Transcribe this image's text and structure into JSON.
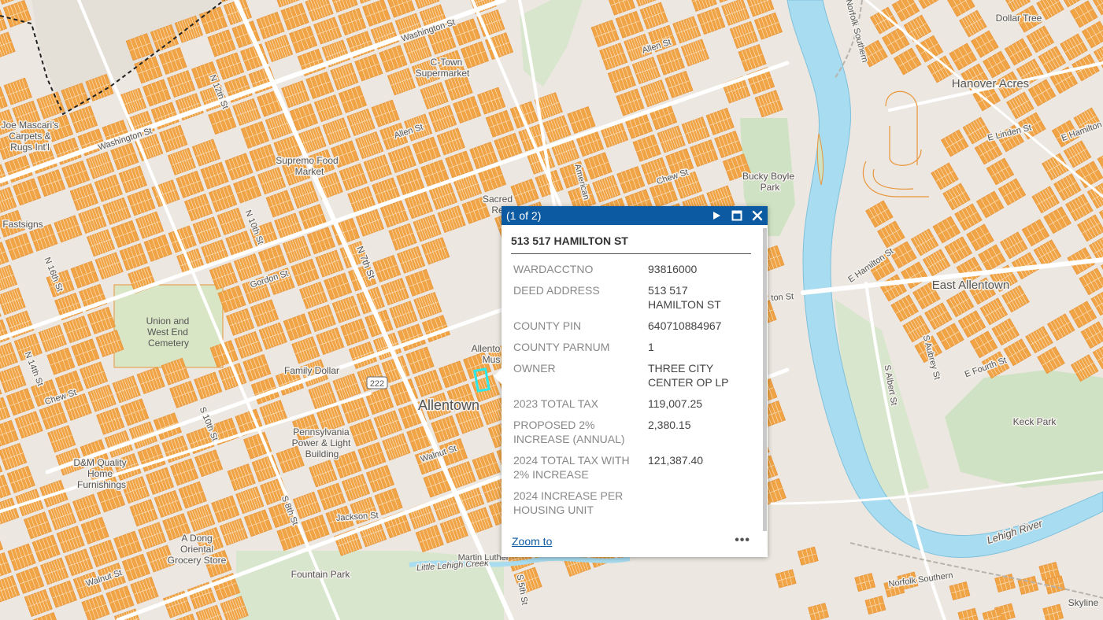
{
  "map": {
    "colors": {
      "background": "#ece8e1",
      "parcel_fill": "#f0a445",
      "parcel_line": "#e8953b",
      "road": "#ffffff",
      "river": "#a8dcf0",
      "river_edge": "#7fc0dc",
      "park": "#cfe2c3",
      "cemetery": "#d9e6c6",
      "selected": "#2ee7e7"
    },
    "labels": {
      "place_hanover_acres": "Hanover Acres",
      "place_east_allentown": "East Allentown",
      "place_allentown": "Allentown",
      "park_bucky_boyle_1": "Bucky Boyle",
      "park_bucky_boyle_2": "Park",
      "park_keck": "Keck Park",
      "park_fountain": "Fountain Park",
      "cemetery_1": "Union and",
      "cemetery_2": "West End",
      "cemetery_3": "Cemetery",
      "river_lehigh": "Lehigh River",
      "creek_little_lehigh": "Little Lehigh Creek",
      "rail_norfolk_1": "Norfolk Southern",
      "rail_norfolk_2": "Norfolk Southern",
      "poi_mascaris_1": "Joe Mascari's",
      "poi_mascaris_2": "Carpets &",
      "poi_mascaris_3": "Rugs Int'l",
      "poi_fastsigns": "Fastsigns",
      "poi_supremo_1": "Supremo Food",
      "poi_supremo_2": "Market",
      "poi_ctown_1": "C-Town",
      "poi_ctown_2": "Supermarket",
      "poi_family_dollar": "Family Dollar",
      "poi_ppl_1": "Pennsylvania",
      "poi_ppl_2": "Power & Light",
      "poi_ppl_3": "Building",
      "poi_dm_1": "D&M Quality",
      "poi_dm_2": "Home",
      "poi_dm_3": "Furnishings",
      "poi_adong_1": "A Dong",
      "poi_adong_2": "Oriental",
      "poi_adong_3": "Grocery Store",
      "poi_dollar_tree": "Dollar Tree",
      "poi_skyline": "Skyline",
      "poi_allentown_museum_1": "Allento",
      "poi_allentown_museum_2": "Mus",
      "poi_sacred_1": "Sacred",
      "poi_sacred_2": "Re",
      "st_washington_1": "Washington St",
      "st_washington_2": "Washington St",
      "st_allen_1": "Allen St",
      "st_allen_2": "Allen St",
      "st_gordon": "Gordon St",
      "st_chew_1": "Chew St",
      "st_chew_2": "Chew St",
      "st_walnut_1": "Walnut St",
      "st_walnut_2": "Walnut St",
      "st_jackson": "Jackson St",
      "st_linden": "E Linden St",
      "st_e_hamilton_1": "E Hamilton St",
      "st_e_hamilton_2": "E Hamilton",
      "st_hamilton_bridge": "ton St",
      "st_n7th": "N 7th St",
      "st_n12th": "N 12th St",
      "st_n10th": "N 10th St",
      "st_n14th": "N 14th St",
      "st_n16th": "N 16th St",
      "st_s10th": "S 10th St",
      "st_s5th": "S 5th St",
      "st_s8th": "S 8th St",
      "st_s_albert": "S Albert St",
      "st_s_aubrey": "S Aubrey St",
      "st_american": "American",
      "st_e_fourth": "E Fourth St",
      "st_e_fifth": "E Fifth St",
      "st_martin_luther": "Martin Luther",
      "route_222": "222",
      "route_222_alt": "222"
    }
  },
  "popup": {
    "count": "(1 of 2)",
    "title": "513 517 HAMILTON ST",
    "fields": [
      {
        "key": "WARDACCTNO",
        "value": "93816000"
      },
      {
        "key": "DEED ADDRESS",
        "value": "513 517\nHAMILTON ST"
      },
      {
        "key": "COUNTY PIN",
        "value": "640710884967"
      },
      {
        "key": "COUNTY PARNUM",
        "value": "1"
      },
      {
        "key": "OWNER",
        "value": "THREE CITY\nCENTER OP LP"
      },
      {
        "key": "2023 TOTAL TAX",
        "value": "119,007.25"
      },
      {
        "key": "PROPOSED 2%\nINCREASE (ANNUAL)",
        "value": "2,380.15"
      },
      {
        "key": "2024 TOTAL TAX WITH\n2% INCREASE",
        "value": "121,387.40"
      },
      {
        "key": "2024 INCREASE PER\nHOUSING UNIT",
        "value": ""
      }
    ],
    "zoom_to": "Zoom to",
    "more": "•••",
    "icons": {
      "next": "play-icon",
      "maximize": "maximize-icon",
      "close": "close-icon"
    },
    "colors": {
      "header": "#0c5aa1",
      "link": "#0c5aa1"
    }
  }
}
